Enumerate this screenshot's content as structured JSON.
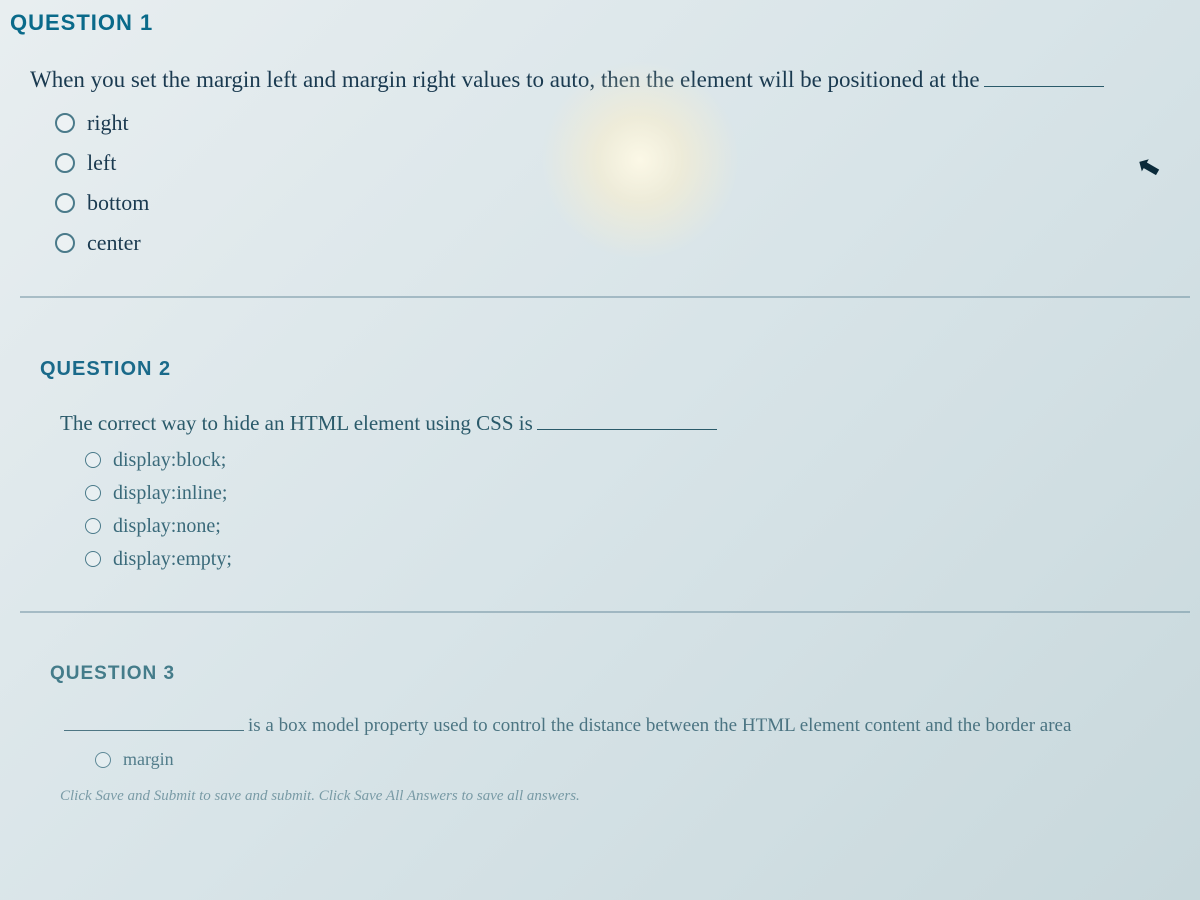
{
  "questions": [
    {
      "header": "QUESTION 1",
      "text_before": "When you set the margin left and margin right values to auto, then the element will be positioned at the",
      "options": [
        "right",
        "left",
        "bottom",
        "center"
      ]
    },
    {
      "header": "QUESTION 2",
      "text_before": "The correct way to hide an HTML element using CSS is",
      "options": [
        "display:block;",
        "display:inline;",
        "display:none;",
        "display:empty;"
      ]
    },
    {
      "header": "QUESTION 3",
      "text_after": "is a box model property used to control the distance between the HTML element content and the border area",
      "options": [
        "margin"
      ]
    }
  ],
  "footer": "Click Save and Submit to save and submit. Click Save All Answers to save all answers."
}
